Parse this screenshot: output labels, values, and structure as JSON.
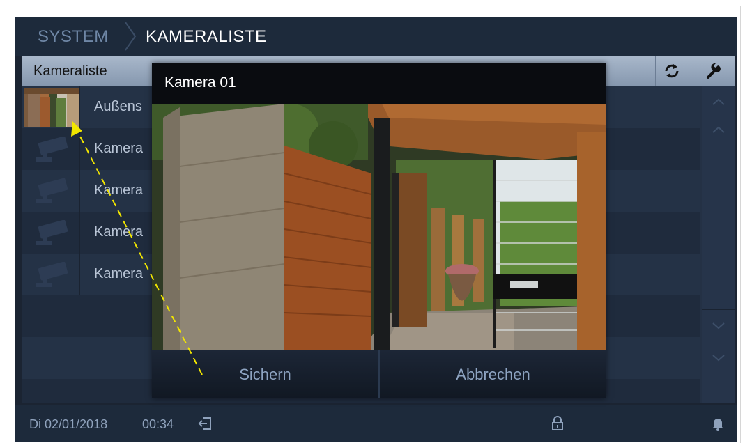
{
  "header": {
    "breadcrumb_root": "SYSTEM",
    "breadcrumb_current": "KAMERALISTE"
  },
  "list": {
    "title": "Kameraliste",
    "refresh_icon": "refresh-icon",
    "settings_icon": "wrench-icon",
    "items": [
      {
        "label": "Außens",
        "icon": "camera-thumbnail"
      },
      {
        "label": "Kamera",
        "icon": "camera-icon"
      },
      {
        "label": "Kamera",
        "icon": "camera-icon"
      },
      {
        "label": "Kamera",
        "icon": "camera-icon"
      },
      {
        "label": "Kamera",
        "icon": "camera-icon"
      }
    ]
  },
  "dialog": {
    "title": "Kamera 01",
    "save_label": "Sichern",
    "cancel_label": "Abbrechen"
  },
  "status": {
    "date": "Di 02/01/2018",
    "time": "00:34"
  },
  "colors": {
    "screen_bg": "#1b2432",
    "header_bar": "#95a6bc",
    "accent_text": "#8ea4c2",
    "annotation_arrow": "#f2e600"
  }
}
